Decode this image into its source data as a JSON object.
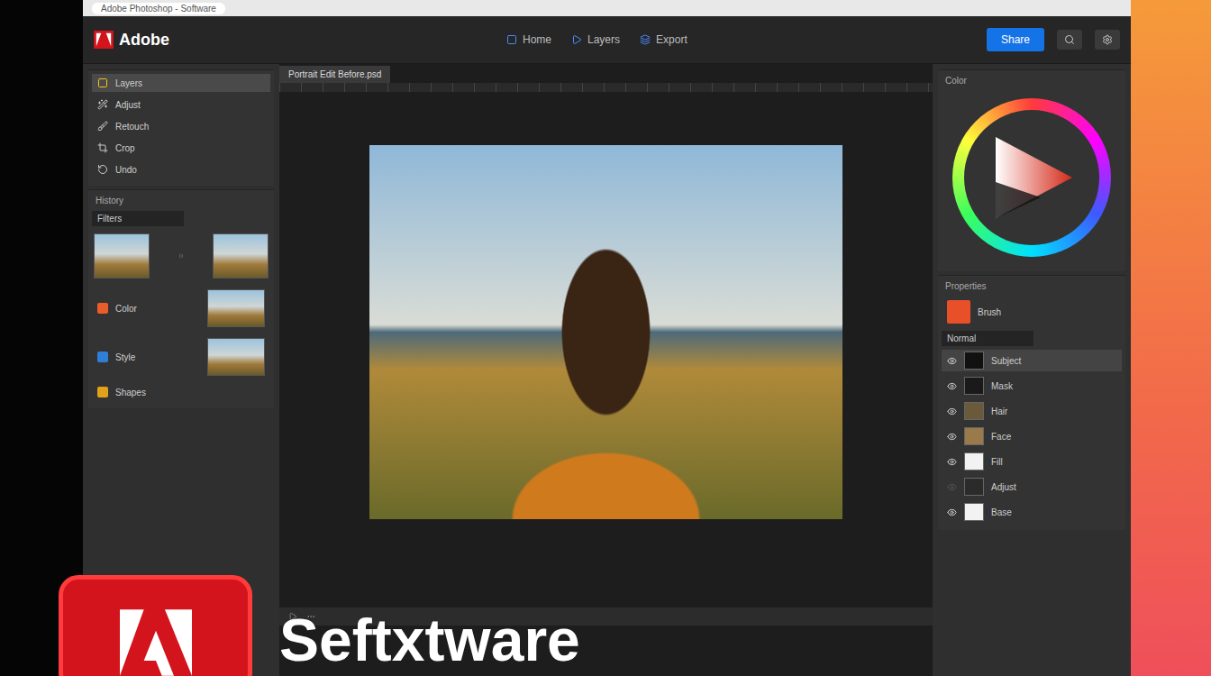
{
  "browser": {
    "address": "Adobe Photoshop - Software"
  },
  "app": {
    "brand": "Adobe",
    "menu": [
      "Home",
      "Layers",
      "Export"
    ],
    "cta": "Share",
    "doc_tab": "Portrait Edit Before.psd"
  },
  "tools": [
    {
      "label": "Layers",
      "selected": true
    },
    {
      "label": "Adjust",
      "selected": false
    },
    {
      "label": "Retouch",
      "selected": false
    },
    {
      "label": "Crop",
      "selected": false
    },
    {
      "label": "Undo",
      "selected": false
    }
  ],
  "history": {
    "title": "History",
    "field": "Filters"
  },
  "assets": [
    {
      "label": "Color",
      "color": "#e85d2a"
    },
    {
      "label": "Style",
      "color": "#2f7fd8"
    },
    {
      "label": "Shapes",
      "color": "#e0a21c"
    }
  ],
  "color": {
    "title": "Color"
  },
  "properties": {
    "title": "Properties",
    "preset": "Brush",
    "mode": "Normal"
  },
  "layers": [
    {
      "name": "Subject",
      "visible": true,
      "selected": true,
      "color": "#111111"
    },
    {
      "name": "Mask",
      "visible": true,
      "selected": false,
      "color": "#1a1a1a"
    },
    {
      "name": "Hair",
      "visible": true,
      "selected": false,
      "color": "#6b5a3a"
    },
    {
      "name": "Face",
      "visible": true,
      "selected": false,
      "color": "#9a7a4a"
    },
    {
      "name": "Fill",
      "visible": true,
      "selected": false,
      "color": "#f2f2f2"
    },
    {
      "name": "Adjust",
      "visible": false,
      "selected": false,
      "color": "#2b2b2b"
    },
    {
      "name": "Base",
      "visible": true,
      "selected": false,
      "color": "#f2f2f2"
    }
  ],
  "headline": "Seftxtware"
}
